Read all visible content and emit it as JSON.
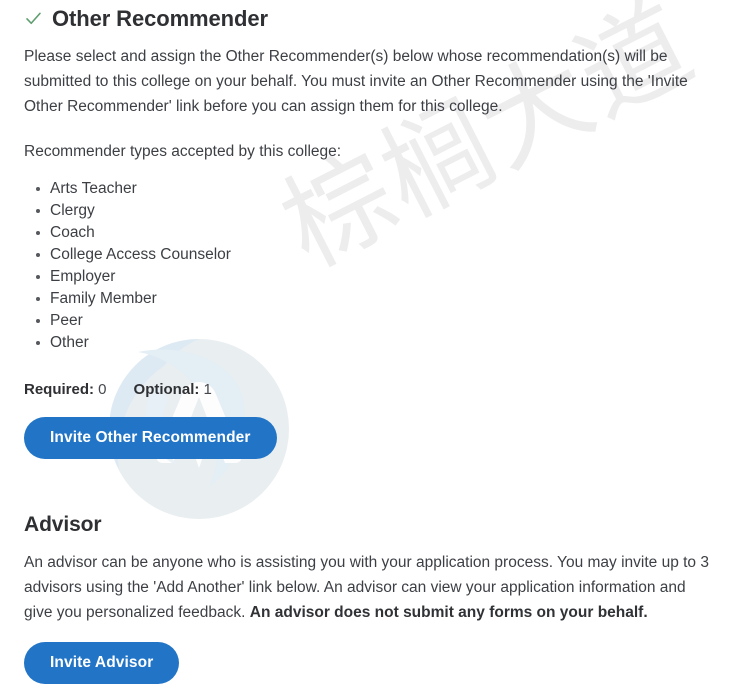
{
  "section": {
    "status_icon": "check-icon",
    "title": "Other Recommender",
    "description": "Please select and assign the Other Recommender(s) below whose recommendation(s) will be submitted to this college on your behalf. You must invite an Other Recommender using the 'Invite Other Recommender' link before you can assign them for this college.",
    "types_intro": "Recommender types accepted by this college:",
    "types": [
      "Arts Teacher",
      "Clergy",
      "Coach",
      "College Access Counselor",
      "Employer",
      "Family Member",
      "Peer",
      "Other"
    ],
    "counts": {
      "required_label": "Required:",
      "required_value": "0",
      "optional_label": "Optional:",
      "optional_value": "1"
    },
    "invite_button": "Invite Other Recommender"
  },
  "advisor": {
    "heading": "Advisor",
    "description_part1": "An advisor can be anyone who is assisting you with your application process. You may invite up to 3 advisors using the 'Add Another' link below. An advisor can view your application information and give you personalized feedback. ",
    "description_bold": "An advisor does not submit any forms on your behalf.",
    "invite_button": "Invite Advisor"
  },
  "watermark": {
    "text": "棕榈大道",
    "logo": "palm-logo-watermark"
  },
  "colors": {
    "accent_blue": "#2275c6",
    "check_green": "#5f9e6e",
    "body_text": "#3c3f44",
    "heading_text": "#2f3033",
    "watermark_gray": "#ededee",
    "watermark_blue": "#eaf2f8"
  }
}
